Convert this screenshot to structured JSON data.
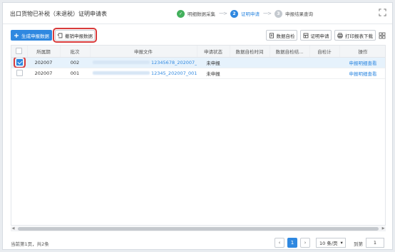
{
  "header": {
    "title": "出口货物已补税（未退税）证明申请表",
    "steps": [
      {
        "number": "✓",
        "label": "明细数据采集",
        "state": "done"
      },
      {
        "number": "2",
        "label": "证明申请",
        "state": "active"
      },
      {
        "number": "3",
        "label": "申报结果查询",
        "state": "todo"
      }
    ],
    "arrow": "---->"
  },
  "toolbar": {
    "generate_label": "生成申报数据",
    "revoke_label": "撤销申报数据",
    "self_check_label": "数据自检",
    "cert_apply_label": "证明申请",
    "print_label": "打印报表下载"
  },
  "table": {
    "columns": [
      "",
      "所属期",
      "批次",
      "申报文件",
      "申请状态",
      "数据自检时间",
      "数据自检结...",
      "自检计",
      "操作"
    ],
    "rows": [
      {
        "checked": true,
        "period": "202007",
        "batch": "002",
        "file": "12345678_202007_00",
        "status": "未申报",
        "check_time": "",
        "check_result": "",
        "check_count": "",
        "action": "申报明细查看"
      },
      {
        "checked": false,
        "period": "202007",
        "batch": "001",
        "file": "12345_202007_001.xn",
        "status": "未申报",
        "check_time": "",
        "check_result": "",
        "check_count": "",
        "action": "申报明细查看"
      }
    ]
  },
  "footer": {
    "page_info": "当前第1页，共2条",
    "current_page": "1",
    "page_size": "10 条/页",
    "goto_label": "到第",
    "goto_value": "1"
  }
}
